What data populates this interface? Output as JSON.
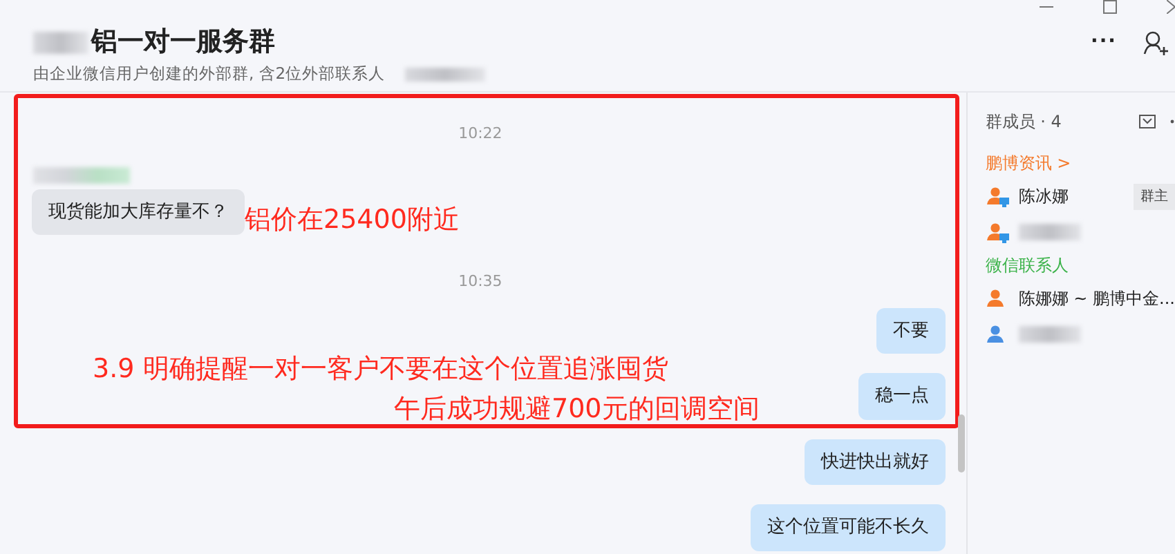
{
  "window": {
    "title": "铝一对一服务群",
    "title_redacted": true,
    "subtitle": "由企业微信用户创建的外部群, 含2位外部联系人",
    "subtitle_redacted": true,
    "more": "···"
  },
  "messages": [
    {
      "kind": "time",
      "text": "10:22"
    },
    {
      "kind": "sender",
      "redacted": true
    },
    {
      "kind": "incoming",
      "text": "现货能加大库存量不？"
    },
    {
      "kind": "time",
      "text": "10:35"
    },
    {
      "kind": "outgoing",
      "text": "不要"
    },
    {
      "kind": "outgoing",
      "text": "稳一点"
    },
    {
      "kind": "outgoing",
      "text": "快进快出就好"
    },
    {
      "kind": "outgoing",
      "text": "这个位置可能不长久"
    }
  ],
  "annotations": [
    {
      "kind": "side",
      "text": "铝价在25400附近"
    },
    {
      "kind": "line1",
      "text": "3.9 明确提醒一对一客户不要在这个位置追涨囤货"
    },
    {
      "kind": "line2",
      "text": "午后成功规避700元的回调空间"
    }
  ],
  "members": {
    "title": "群成员 · 4",
    "groups": [
      {
        "label": "鹏博资讯 >",
        "color": "#f47a2c",
        "members": [
          {
            "kind": "employee",
            "name": "陈冰娜",
            "badge": "群主",
            "redacted": false
          },
          {
            "kind": "employee",
            "redacted": true
          }
        ]
      },
      {
        "label": "微信联系人",
        "color": "#3cb34a",
        "members": [
          {
            "kind": "contact",
            "name": "陈娜娜 ~ 鹏博中金...",
            "redacted": false
          },
          {
            "kind": "contact-blue",
            "redacted": true
          }
        ]
      }
    ]
  }
}
